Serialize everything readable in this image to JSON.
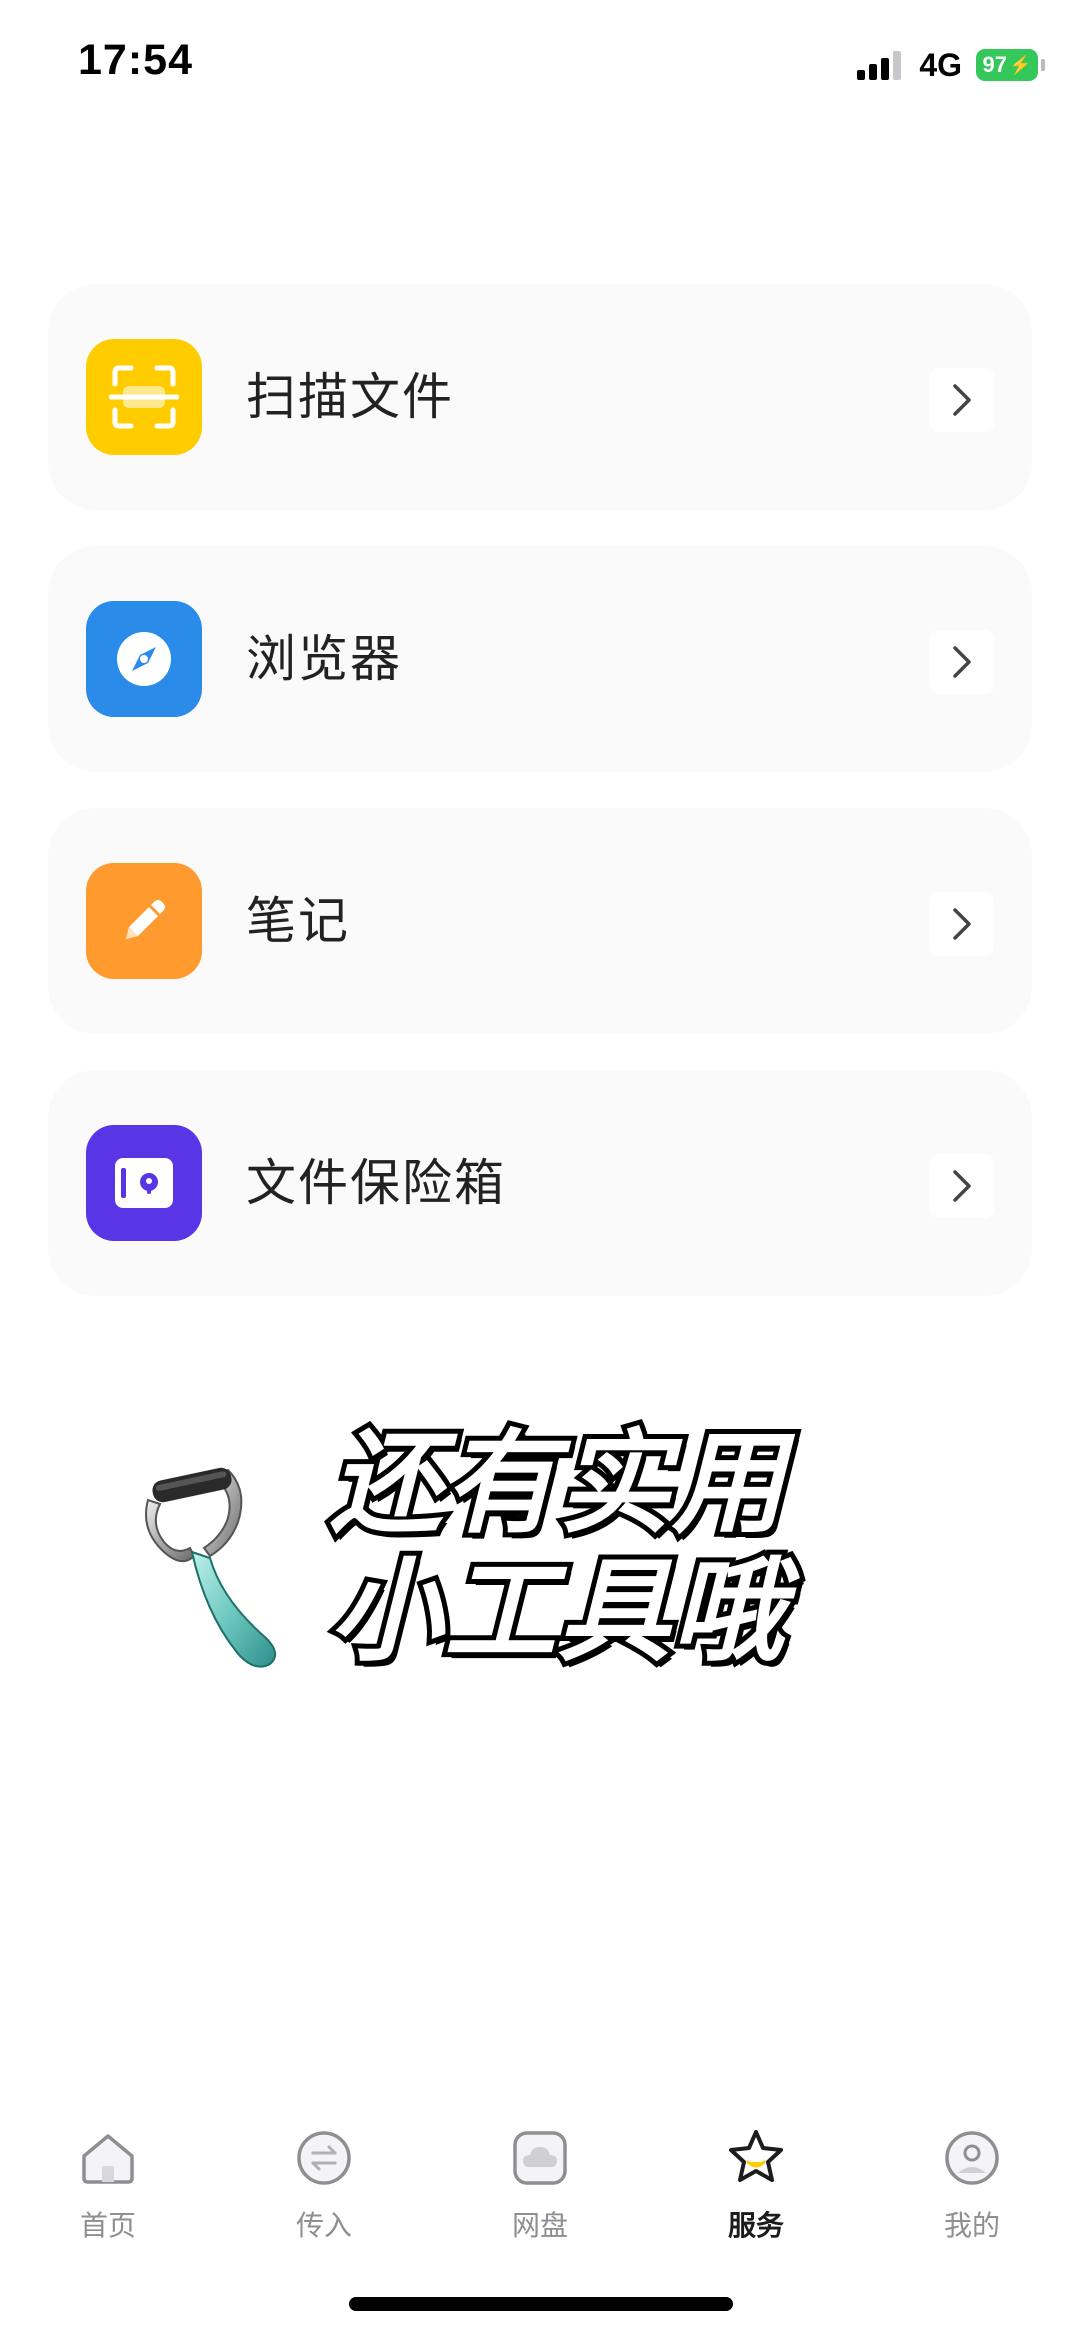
{
  "status_bar": {
    "time": "17:54",
    "network": "4G",
    "battery": "97",
    "battery_color": "#34c759"
  },
  "services": [
    {
      "label": "扫描文件",
      "icon": "scan-icon",
      "color": "#ffcc00"
    },
    {
      "label": "浏览器",
      "icon": "compass-icon",
      "color": "#2b8be8"
    },
    {
      "label": "笔记",
      "icon": "pencil-icon",
      "color": "#ff9a2e"
    },
    {
      "label": "文件保险箱",
      "icon": "safe-icon",
      "color": "#5a35e6"
    }
  ],
  "promo": {
    "line1": "还有实用",
    "line2": "小工具哦"
  },
  "tab_bar": {
    "tabs": [
      {
        "label": "首页",
        "icon": "home-icon"
      },
      {
        "label": "传入",
        "icon": "transfer-icon"
      },
      {
        "label": "网盘",
        "icon": "cloud-drive-icon"
      },
      {
        "label": "服务",
        "icon": "star-icon",
        "active": true
      },
      {
        "label": "我的",
        "icon": "profile-icon"
      }
    ]
  }
}
